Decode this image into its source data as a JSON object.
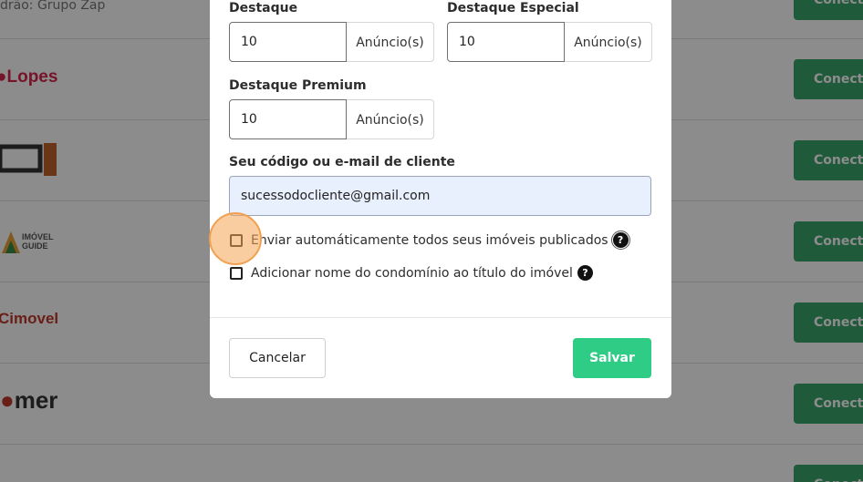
{
  "background": {
    "top_caption": "drão: Grupo Zap",
    "connect_label": "Conecta",
    "logos": [
      "Lopes",
      "",
      "IMÓVEL GUIDE",
      "Cimovel",
      "mer"
    ],
    "colors": {
      "connect_button": "#3aa46b",
      "lopes": "#d7264b"
    }
  },
  "modal": {
    "destaque": {
      "label": "Destaque",
      "value": "10",
      "suffix": "Anúncio(s)"
    },
    "destaque_especial": {
      "label": "Destaque Especial",
      "value": "10",
      "suffix": "Anúncio(s)"
    },
    "destaque_premium": {
      "label": "Destaque Premium",
      "value": "10",
      "suffix": "Anúncio(s)"
    },
    "client_code": {
      "label": "Seu código ou e-mail de cliente",
      "value": "sucessodocliente@gmail.com"
    },
    "checkbox_send_all": {
      "label": "Enviar automáticamente todos seus imóveis publicados",
      "checked": false,
      "help_icon": "question-circle-icon"
    },
    "checkbox_condo_name": {
      "label": "Adicionar nome do condomínio ao título do imóvel",
      "checked": false,
      "help_icon": "question-circle-icon"
    },
    "cancel_label": "Cancelar",
    "save_label": "Salvar",
    "colors": {
      "save_button": "#2ecc85",
      "email_bg": "#e8f0fe"
    }
  },
  "help_glyph": "?"
}
